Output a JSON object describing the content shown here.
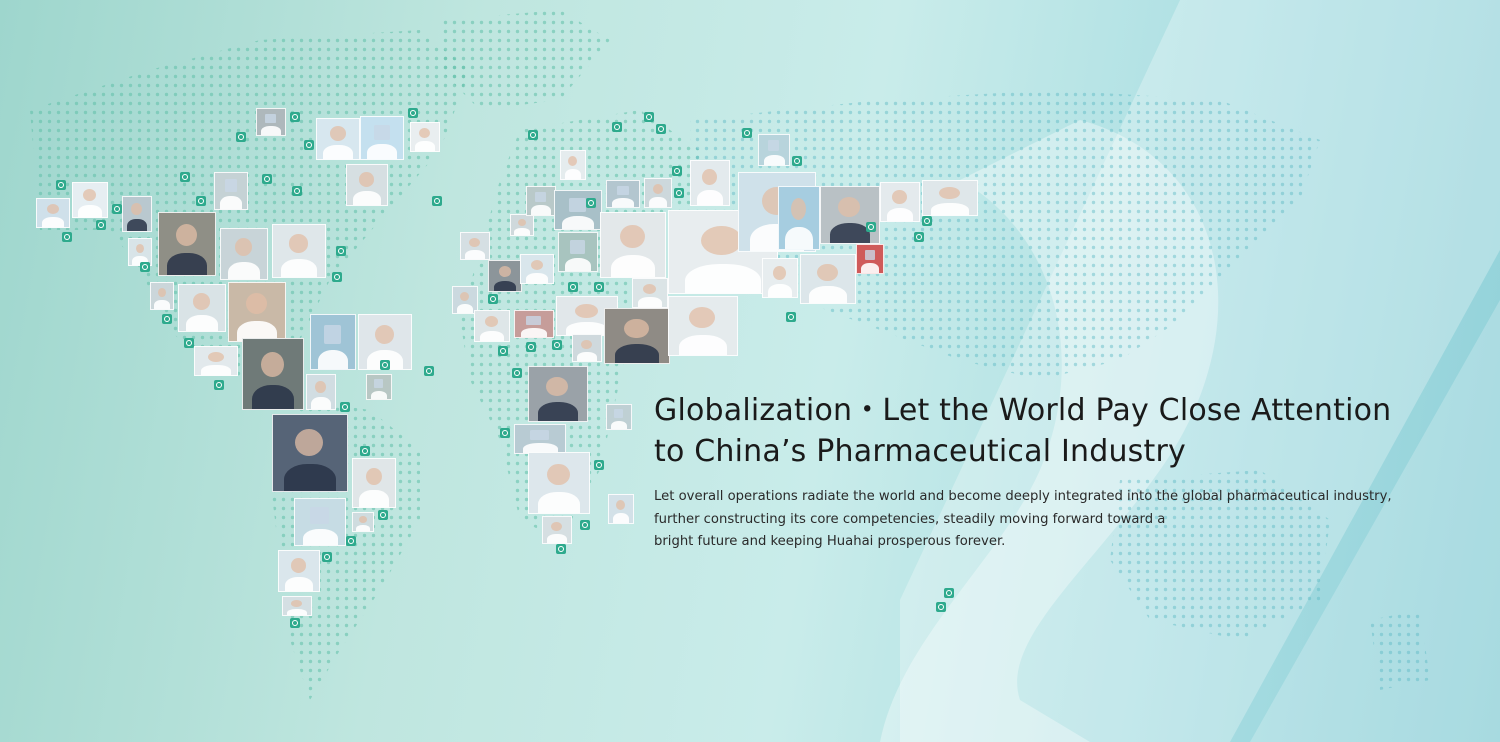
{
  "banner": {
    "headline": {
      "line1": "Globalization・Let the World Pay Close Attention",
      "line2": "to China’s Pharmaceutical Industry"
    },
    "description": {
      "line1": "Let overall operations radiate the world and become deeply integrated into the global pharmaceutical industry,",
      "line2": "further constructing its core competencies, steadily moving forward toward a",
      "line3": "bright future and keeping Huahai prosperous forever."
    }
  },
  "colors": {
    "background_left": "#9ed6cd",
    "background_right": "#8fd0d8",
    "dot_green": "#6cc3ae",
    "logo_green": "#2eaa8d",
    "text_dark": "#1a1a1a"
  }
}
